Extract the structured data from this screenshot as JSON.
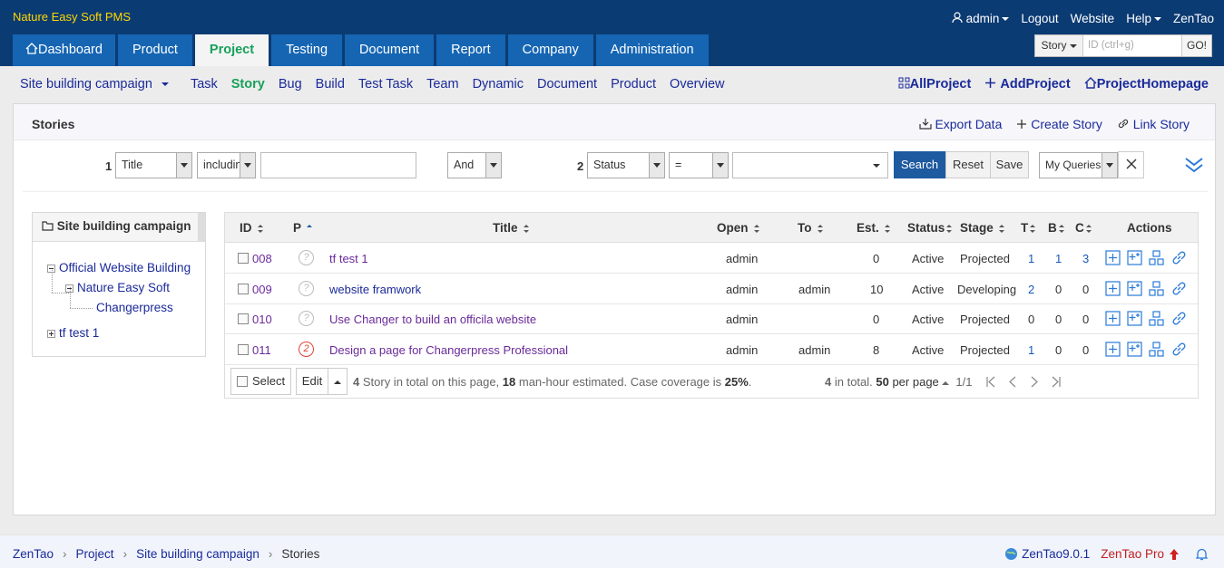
{
  "app": {
    "brand": "Nature Easy Soft PMS"
  },
  "topnav": {
    "user": "admin",
    "logout": "Logout",
    "website": "Website",
    "help": "Help",
    "zentao": "ZenTao"
  },
  "mainnav": [
    "Dashboard",
    "Product",
    "Project",
    "Testing",
    "Document",
    "Report",
    "Company",
    "Administration"
  ],
  "mainnav_active": "Project",
  "search": {
    "type": "Story",
    "placeholder": "ID (ctrl+g)",
    "go": "GO!"
  },
  "subnav": {
    "project": "Site building campaign",
    "items": [
      "Task",
      "Story",
      "Bug",
      "Build",
      "Test Task",
      "Team",
      "Dynamic",
      "Document",
      "Product",
      "Overview"
    ],
    "active": "Story",
    "right": [
      "AllProject",
      "AddProject",
      "ProjectHomepage"
    ]
  },
  "panel": {
    "title": "Stories",
    "export": "Export Data",
    "create": "Create Story",
    "link": "Link Story"
  },
  "filter": {
    "g1": "1",
    "field1": "Title",
    "op1": "includin",
    "and": "And",
    "g2": "2",
    "field2": "Status",
    "op2": "=",
    "search": "Search",
    "reset": "Reset",
    "save": "Save",
    "queries": "My Queries"
  },
  "tree": {
    "title": "Site building campaign",
    "nodes": [
      "Official Website Building",
      "Nature Easy Soft",
      "Changerpress",
      "tf test 1"
    ]
  },
  "columns": [
    "ID",
    "P",
    "Title",
    "Open",
    "To",
    "Est.",
    "Status",
    "Stage",
    "T",
    "B",
    "C",
    "Actions"
  ],
  "rows": [
    {
      "id": "008",
      "pri": "?",
      "title": "tf test 1",
      "open": "admin",
      "to": "",
      "est": "0",
      "status": "Active",
      "stage": "Projected",
      "t": "1",
      "b": "1",
      "c": "3"
    },
    {
      "id": "009",
      "pri": "?",
      "title": "website framwork",
      "open": "admin",
      "to": "admin",
      "est": "10",
      "status": "Active",
      "stage": "Developing",
      "t": "2",
      "b": "0",
      "c": "0"
    },
    {
      "id": "010",
      "pri": "?",
      "title": "Use Changer to build an officila website",
      "open": "admin",
      "to": "",
      "est": "0",
      "status": "Active",
      "stage": "Projected",
      "t": "0",
      "b": "0",
      "c": "0"
    },
    {
      "id": "011",
      "pri": "2",
      "title": "Design a page for Changerpress Professional",
      "open": "admin",
      "to": "admin",
      "est": "8",
      "status": "Active",
      "stage": "Projected",
      "t": "1",
      "b": "0",
      "c": "0"
    }
  ],
  "gridfoot": {
    "select": "Select",
    "edit": "Edit",
    "count": "4",
    "s1": " Story in total on this page, ",
    "hours": "18",
    "s2": " man-hour estimated. Case coverage is ",
    "cov": "25%",
    "s3": ".",
    "total": "4",
    "s4": " in total. ",
    "perpage": "50",
    "s5": " per page",
    "pages": "1/1"
  },
  "footer": {
    "crumbs": [
      "ZenTao",
      "Project",
      "Site building campaign",
      "Stories"
    ],
    "version": "ZenTao9.0.1",
    "pro": "ZenTao Pro"
  },
  "colors": {
    "header": "#0b3b73",
    "tab": "#1565b3",
    "active": "#18a05a",
    "link": "#1a2a9a"
  }
}
